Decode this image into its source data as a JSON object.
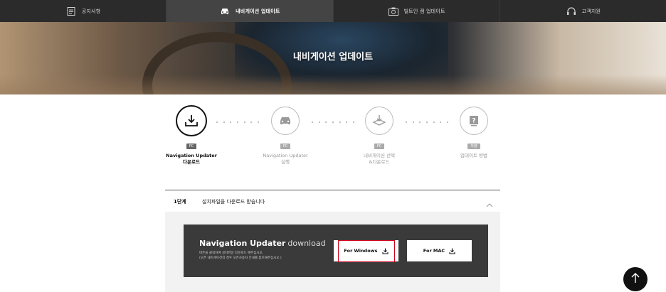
{
  "topnav": {
    "tabs": [
      {
        "label": "공지사항",
        "icon": "notice-icon"
      },
      {
        "label": "내비게이션 업데이트",
        "icon": "car-icon",
        "active": true
      },
      {
        "label": "빌트인 캠 업데이트",
        "icon": "camera-icon"
      },
      {
        "label": "고객지원",
        "icon": "headset-icon"
      }
    ]
  },
  "hero": {
    "title": "내비게이션 업데이트"
  },
  "steps": [
    {
      "badge": "PC",
      "label_line1": "Navigation Updater",
      "label_line2": "다운로드",
      "icon": "download-icon",
      "active": true
    },
    {
      "badge": "PC",
      "label_line1": "Navigation Updater",
      "label_line2": "실행",
      "icon": "car-icon"
    },
    {
      "badge": "PC",
      "label_line1": "내비게이션 선택",
      "label_line2": "&다운로드",
      "icon": "map-download-icon"
    },
    {
      "badge": "차량",
      "label_line1": "업데이트 방법",
      "label_line2": "",
      "icon": "help-icon"
    }
  ],
  "accordion": {
    "step_no": "1단계",
    "title": "설치파일을 다운로드 받습니다",
    "expanded": true
  },
  "download": {
    "heading_bold": "Navigation Updater",
    "heading_light": "download",
    "note_line1": "버튼을 클릭하여 설치파일 다운로드 해주십시오.",
    "note_line2": "(오픈 내비게이션의 경우 오픈사용자 안내를 참조해주십시오.)",
    "windows_label": "For Windows",
    "mac_label": "For MAC"
  },
  "colors": {
    "topnav_bg": "#2b2b2b",
    "download_box_bg": "#3a3a3a",
    "highlight": "#d0021b"
  }
}
